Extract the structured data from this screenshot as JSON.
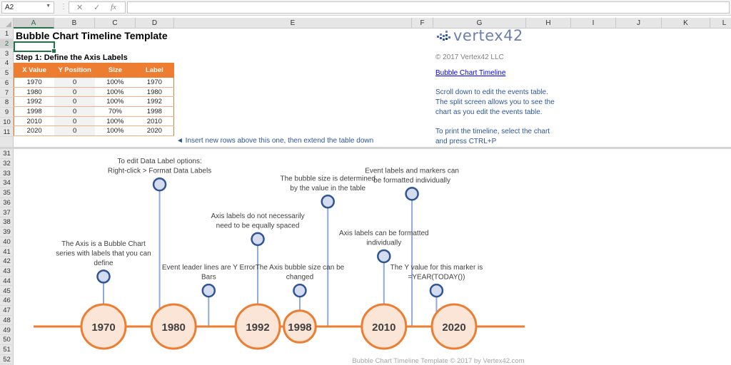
{
  "formula_bar": {
    "name_box": "A2",
    "cancel_icon": "✕",
    "enter_icon": "✓",
    "function_icon": "fx",
    "formula": ""
  },
  "columns": [
    "A",
    "B",
    "C",
    "D",
    "E",
    "F",
    "G",
    "H",
    "I",
    "J",
    "K",
    "L"
  ],
  "selected_column": "A",
  "rows_top": [
    "1",
    "2",
    "3",
    "4",
    "5",
    "6",
    "7",
    "8",
    "9",
    "10",
    "11"
  ],
  "rows_bottom": [
    "31",
    "32",
    "33",
    "34",
    "35",
    "36",
    "37",
    "38",
    "39",
    "40",
    "41",
    "42",
    "43",
    "44",
    "45",
    "46",
    "47",
    "48",
    "49",
    "50",
    "51",
    "52"
  ],
  "sheet": {
    "title": "Bubble Chart Timeline Template",
    "step1": "Step 1: Define the Axis Labels",
    "axis_table": {
      "headers": [
        "X Value",
        "Y Position",
        "Size",
        "Label"
      ],
      "rows": [
        [
          "1970",
          "0",
          "100%",
          "1970"
        ],
        [
          "1980",
          "0",
          "100%",
          "1980"
        ],
        [
          "1992",
          "0",
          "100%",
          "1992"
        ],
        [
          "1998",
          "0",
          "70%",
          "1998"
        ],
        [
          "2010",
          "0",
          "100%",
          "2010"
        ],
        [
          "2020",
          "0",
          "100%",
          "2020"
        ]
      ]
    },
    "insert_note": "◄ Insert new rows above this one, then extend the table down",
    "logo_text": "vertex42",
    "copyright": "© 2017 Vertex42 LLC",
    "link": "Bubble Chart Timeline",
    "info_lines": [
      "Scroll down to edit the events table.",
      "The split screen allows you to see the",
      "chart as you edit the events table.",
      "",
      "To print the timeline, select the chart",
      "and press CTRL+P"
    ]
  },
  "colors": {
    "accent_orange": "#ed7d31",
    "bubble_fill": "#fbe5d6",
    "marker_stroke": "#2f5597",
    "marker_fill": "#d6dcf0",
    "leader_line": "#8faadc",
    "excel_green": "#217346"
  },
  "chart_data": {
    "type": "scatter",
    "title": "",
    "footer": "Bubble Chart Timeline Template © 2017 by Vertex42.com",
    "xlim": [
      1964,
      2030
    ],
    "ylim": [
      0,
      10
    ],
    "axis_series": [
      {
        "x": 1970,
        "y": 0,
        "size": 1.0,
        "label": "1970"
      },
      {
        "x": 1980,
        "y": 0,
        "size": 1.0,
        "label": "1980"
      },
      {
        "x": 1992,
        "y": 0,
        "size": 1.0,
        "label": "1992"
      },
      {
        "x": 1998,
        "y": 0,
        "size": 0.7,
        "label": "1998"
      },
      {
        "x": 2010,
        "y": 0,
        "size": 1.0,
        "label": "2010"
      },
      {
        "x": 2020,
        "y": 0,
        "size": 1.0,
        "label": "2020"
      }
    ],
    "events": [
      {
        "x": 1970,
        "y": 3.2,
        "label": [
          "The Axis is a Bubble Chart",
          "series with labels that you can",
          "define"
        ]
      },
      {
        "x": 1978,
        "y": 9.1,
        "label": [
          "To edit Data Label options:",
          "Right-click > Format Data Labels"
        ]
      },
      {
        "x": 1985,
        "y": 2.3,
        "label": [
          "Event leader lines are Y Error",
          "Bars"
        ]
      },
      {
        "x": 1992,
        "y": 5.6,
        "label": [
          "Axis labels do not necessarily",
          "need to be equally spaced"
        ]
      },
      {
        "x": 1998,
        "y": 2.3,
        "label": [
          "The Axis bubble size can be",
          "changed"
        ]
      },
      {
        "x": 2002,
        "y": 8.0,
        "label": [
          "The bubble size is determined",
          "by the value in the table"
        ]
      },
      {
        "x": 2010,
        "y": 4.5,
        "label": [
          "Axis labels can be formatted",
          "individually"
        ]
      },
      {
        "x": 2014,
        "y": 8.5,
        "label": [
          "Event labels and markers can",
          "be formatted individually"
        ]
      },
      {
        "x": 2017.5,
        "y": 2.3,
        "label": [
          "The Y value for this marker is",
          "=YEAR(TODAY())"
        ]
      }
    ]
  }
}
